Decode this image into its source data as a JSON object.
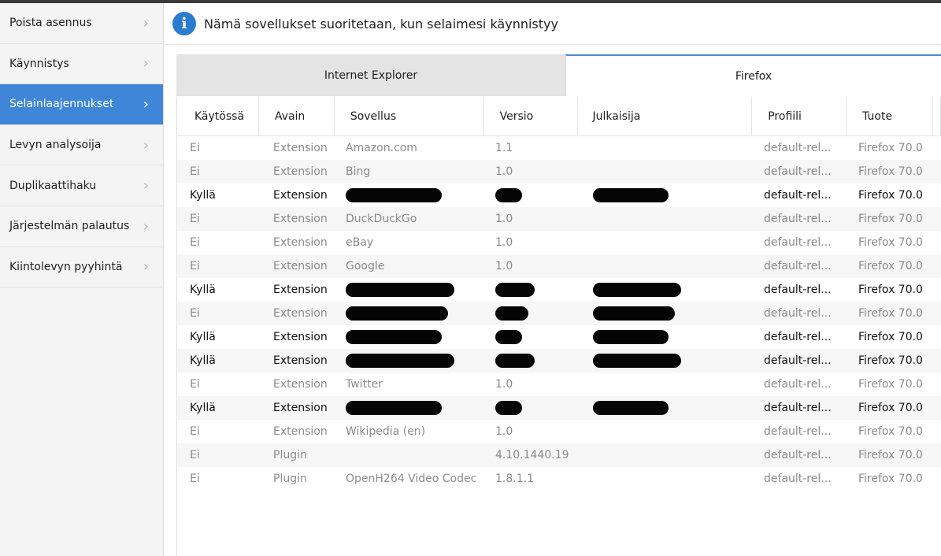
{
  "sidebar": {
    "items": [
      {
        "label": "Poista asennus",
        "active": false
      },
      {
        "label": "Käynnistys",
        "active": false
      },
      {
        "label": "Selainlaajennukset",
        "active": true
      },
      {
        "label": "Levyn analysoija",
        "active": false
      },
      {
        "label": "Duplikaattihaku",
        "active": false
      },
      {
        "label": "Järjestelmän palautus",
        "active": false
      },
      {
        "label": "Kiintolevyn pyyhintä",
        "active": false
      }
    ],
    "chevron": "›"
  },
  "info": {
    "icon": "info-icon",
    "glyph": "i",
    "text": "Nämä sovellukset suoritetaan, kun selaimesi käynnistyy"
  },
  "tabs": [
    {
      "label": "Internet Explorer",
      "active": false
    },
    {
      "label": "Firefox",
      "active": true
    }
  ],
  "table": {
    "headers": [
      "Käytössä",
      "Avain",
      "Sovellus",
      "Versio",
      "Julkaisija",
      "Profiili",
      "Tuote"
    ],
    "rows": [
      {
        "enabled": "Ei",
        "key": "Extension",
        "app": "Amazon.com",
        "version": "1.1",
        "publisher": "",
        "profile": "default-rel...",
        "product": "Firefox 70.0",
        "redacted": false
      },
      {
        "enabled": "Ei",
        "key": "Extension",
        "app": "Bing",
        "version": "1.0",
        "publisher": "",
        "profile": "default-rel...",
        "product": "Firefox 70.0",
        "redacted": false
      },
      {
        "enabled": "Kyllä",
        "key": "Extension",
        "app": "",
        "version": "",
        "publisher": "",
        "profile": "default-rel...",
        "product": "Firefox 70.0",
        "redacted": true
      },
      {
        "enabled": "Ei",
        "key": "Extension",
        "app": "DuckDuckGo",
        "version": "1.0",
        "publisher": "",
        "profile": "default-rel...",
        "product": "Firefox 70.0",
        "redacted": false
      },
      {
        "enabled": "Ei",
        "key": "Extension",
        "app": "eBay",
        "version": "1.0",
        "publisher": "",
        "profile": "default-rel...",
        "product": "Firefox 70.0",
        "redacted": false
      },
      {
        "enabled": "Ei",
        "key": "Extension",
        "app": "Google",
        "version": "1.0",
        "publisher": "",
        "profile": "default-rel...",
        "product": "Firefox 70.0",
        "redacted": false
      },
      {
        "enabled": "Kyllä",
        "key": "Extension",
        "app": "",
        "version": "",
        "publisher": "",
        "profile": "default-rel...",
        "product": "Firefox 70.0",
        "redacted": true
      },
      {
        "enabled": "Ei",
        "key": "Extension",
        "app": "",
        "version": "",
        "publisher": "",
        "profile": "default-rel...",
        "product": "Firefox 70.0",
        "redacted": true
      },
      {
        "enabled": "Kyllä",
        "key": "Extension",
        "app": "",
        "version": "",
        "publisher": "",
        "profile": "default-rel...",
        "product": "Firefox 70.0",
        "redacted": true
      },
      {
        "enabled": "Kyllä",
        "key": "Extension",
        "app": "",
        "version": "",
        "publisher": "",
        "profile": "default-rel...",
        "product": "Firefox 70.0",
        "redacted": true
      },
      {
        "enabled": "Ei",
        "key": "Extension",
        "app": "Twitter",
        "version": "1.0",
        "publisher": "",
        "profile": "default-rel...",
        "product": "Firefox 70.0",
        "redacted": false
      },
      {
        "enabled": "Kyllä",
        "key": "Extension",
        "app": "",
        "version": "",
        "publisher": "",
        "profile": "default-rel...",
        "product": "Firefox 70.0",
        "redacted": true
      },
      {
        "enabled": "Ei",
        "key": "Extension",
        "app": "Wikipedia (en)",
        "version": "1.0",
        "publisher": "",
        "profile": "default-rel...",
        "product": "Firefox 70.0",
        "redacted": false
      },
      {
        "enabled": "Ei",
        "key": "Plugin",
        "app": "",
        "version": "4.10.1440.19",
        "publisher": "",
        "profile": "default-rel...",
        "product": "Firefox 70.0",
        "redacted": false
      },
      {
        "enabled": "Ei",
        "key": "Plugin",
        "app": "OpenH264 Video Codec",
        "version": "1.8.1.1",
        "publisher": "",
        "profile": "default-rel...",
        "product": "Firefox 70.0",
        "redacted": false
      }
    ]
  },
  "colors": {
    "accent": "#3f86d8",
    "info_icon": "#2b7bd0",
    "disabled_text": "#8a8a8a",
    "redaction": "#050505"
  }
}
